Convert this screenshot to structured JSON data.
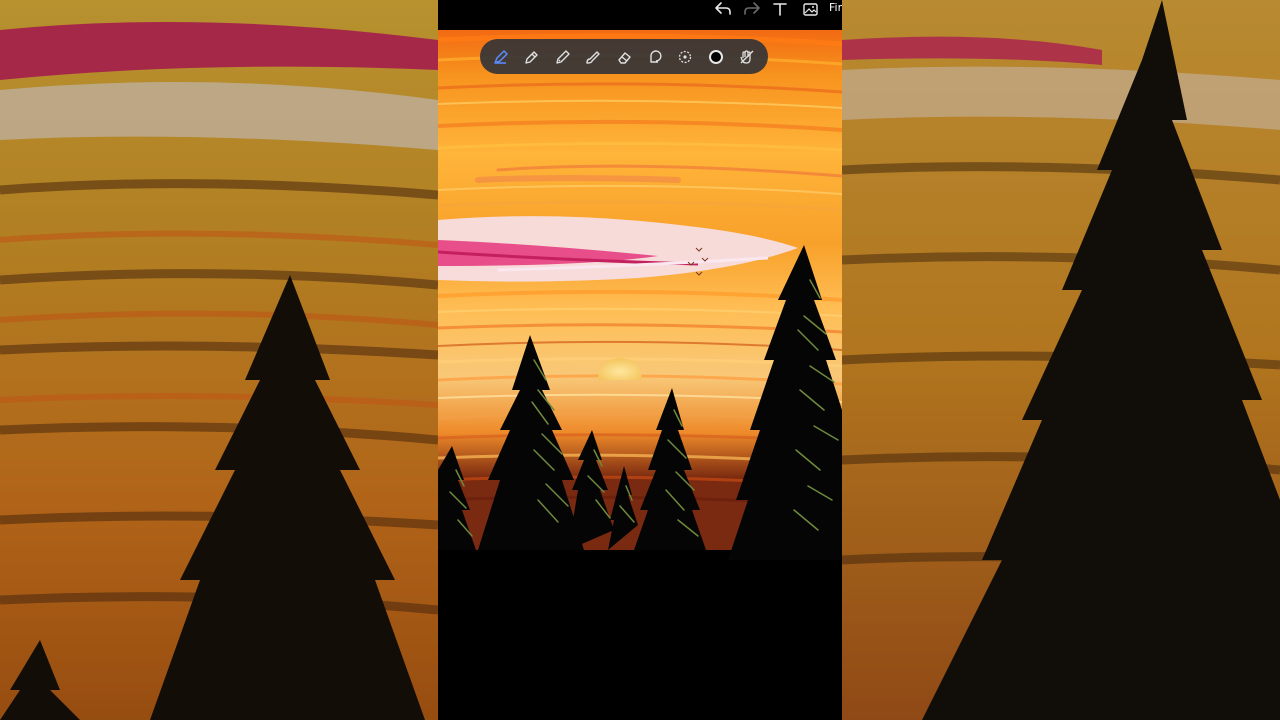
{
  "app": {
    "finish_label": "Fin"
  },
  "topbar": {
    "icons": [
      "undo-icon",
      "redo-icon",
      "text-icon",
      "image-icon"
    ]
  },
  "toolbar": {
    "tools": [
      {
        "name": "pen-tool",
        "active": true
      },
      {
        "name": "marker-tool",
        "active": false
      },
      {
        "name": "pencil-tool",
        "active": false
      },
      {
        "name": "brush-tool",
        "active": false
      },
      {
        "name": "eraser-tool",
        "active": false
      },
      {
        "name": "lasso-tool",
        "active": false
      },
      {
        "name": "spray-tool",
        "active": false
      },
      {
        "name": "color-picker",
        "active": false
      },
      {
        "name": "hand-tool",
        "active": false
      }
    ],
    "selected_color": "#000000"
  },
  "colors": {
    "sky_orange": "#f7931e",
    "sky_light": "#ffc56b",
    "pink": "#e5357a",
    "cloud_white": "#f6dfe8",
    "tree_green": "#6f8a3c",
    "tool_active": "#5b8cff"
  }
}
